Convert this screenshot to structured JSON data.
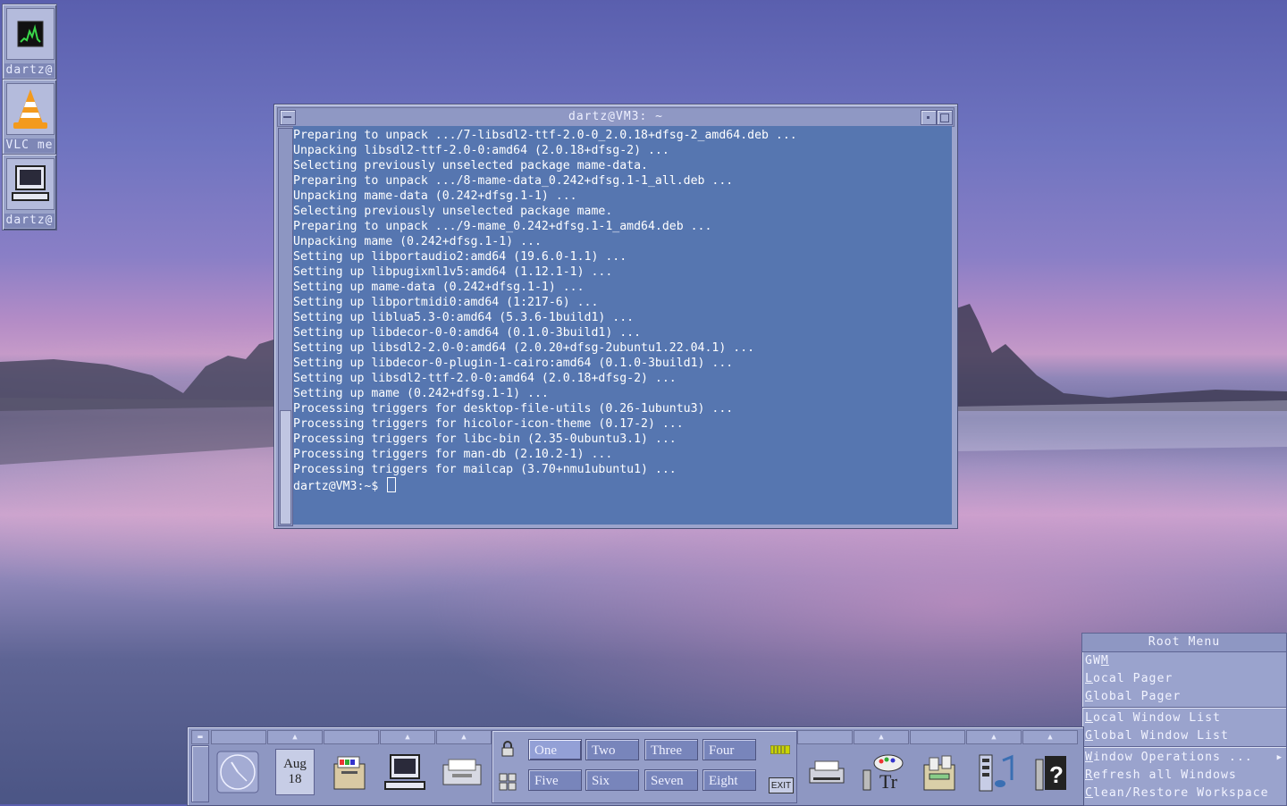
{
  "desktop_icons": [
    {
      "label": "dartz@",
      "icon": "system-monitor-icon"
    },
    {
      "label": "VLC me",
      "icon": "vlc-cone-icon"
    },
    {
      "label": "dartz@",
      "icon": "computer-terminal-icon"
    }
  ],
  "terminal": {
    "title": "dartz@VM3: ~",
    "lines": [
      "Preparing to unpack .../7-libsdl2-ttf-2.0-0_2.0.18+dfsg-2_amd64.deb ...",
      "Unpacking libsdl2-ttf-2.0-0:amd64 (2.0.18+dfsg-2) ...",
      "Selecting previously unselected package mame-data.",
      "Preparing to unpack .../8-mame-data_0.242+dfsg.1-1_all.deb ...",
      "Unpacking mame-data (0.242+dfsg.1-1) ...",
      "Selecting previously unselected package mame.",
      "Preparing to unpack .../9-mame_0.242+dfsg.1-1_amd64.deb ...",
      "Unpacking mame (0.242+dfsg.1-1) ...",
      "Setting up libportaudio2:amd64 (19.6.0-1.1) ...",
      "Setting up libpugixml1v5:amd64 (1.12.1-1) ...",
      "Setting up mame-data (0.242+dfsg.1-1) ...",
      "Setting up libportmidi0:amd64 (1:217-6) ...",
      "Setting up liblua5.3-0:amd64 (5.3.6-1build1) ...",
      "Setting up libdecor-0-0:amd64 (0.1.0-3build1) ...",
      "Setting up libsdl2-2.0-0:amd64 (2.0.20+dfsg-2ubuntu1.22.04.1) ...",
      "Setting up libdecor-0-plugin-1-cairo:amd64 (0.1.0-3build1) ...",
      "Setting up libsdl2-ttf-2.0-0:amd64 (2.0.18+dfsg-2) ...",
      "Setting up mame (0.242+dfsg.1-1) ...",
      "Processing triggers for desktop-file-utils (0.26-1ubuntu3) ...",
      "Processing triggers for hicolor-icon-theme (0.17-2) ...",
      "Processing triggers for libc-bin (2.35-0ubuntu3.1) ...",
      "Processing triggers for man-db (2.10.2-1) ...",
      "Processing triggers for mailcap (3.70+nmu1ubuntu1) ..."
    ],
    "prompt": "dartz@VM3:~$ "
  },
  "root_menu": {
    "title": "Root Menu",
    "groups": [
      [
        {
          "label": "GWM",
          "mnemonic": "M"
        },
        {
          "label": "Local Pager",
          "mnemonic": "L"
        },
        {
          "label": "Global Pager",
          "mnemonic": "G"
        }
      ],
      [
        {
          "label": "Local Window List",
          "mnemonic": "L"
        },
        {
          "label": "Global Window List",
          "mnemonic": "G"
        }
      ],
      [
        {
          "label": "Window Operations ...",
          "mnemonic": "W",
          "submenu": true
        },
        {
          "label": "Refresh all Windows",
          "mnemonic": "R"
        },
        {
          "label": "Clean/Restore Workspace",
          "mnemonic": "C"
        }
      ]
    ]
  },
  "panel": {
    "calendar": {
      "month": "Aug",
      "day": "18"
    },
    "workspaces": [
      "One",
      "Two",
      "Three",
      "Four",
      "Five",
      "Six",
      "Seven",
      "Eight"
    ],
    "active_workspace": "One",
    "exit_label": "EXIT",
    "left_icons": [
      "clock-icon",
      "calendar-icon",
      "file-manager-icon",
      "terminal-icon",
      "mail-icon"
    ],
    "right_icons": [
      "printer-icon",
      "style-manager-icon",
      "app-manager-icon",
      "multimedia-icon",
      "help-icon"
    ]
  }
}
